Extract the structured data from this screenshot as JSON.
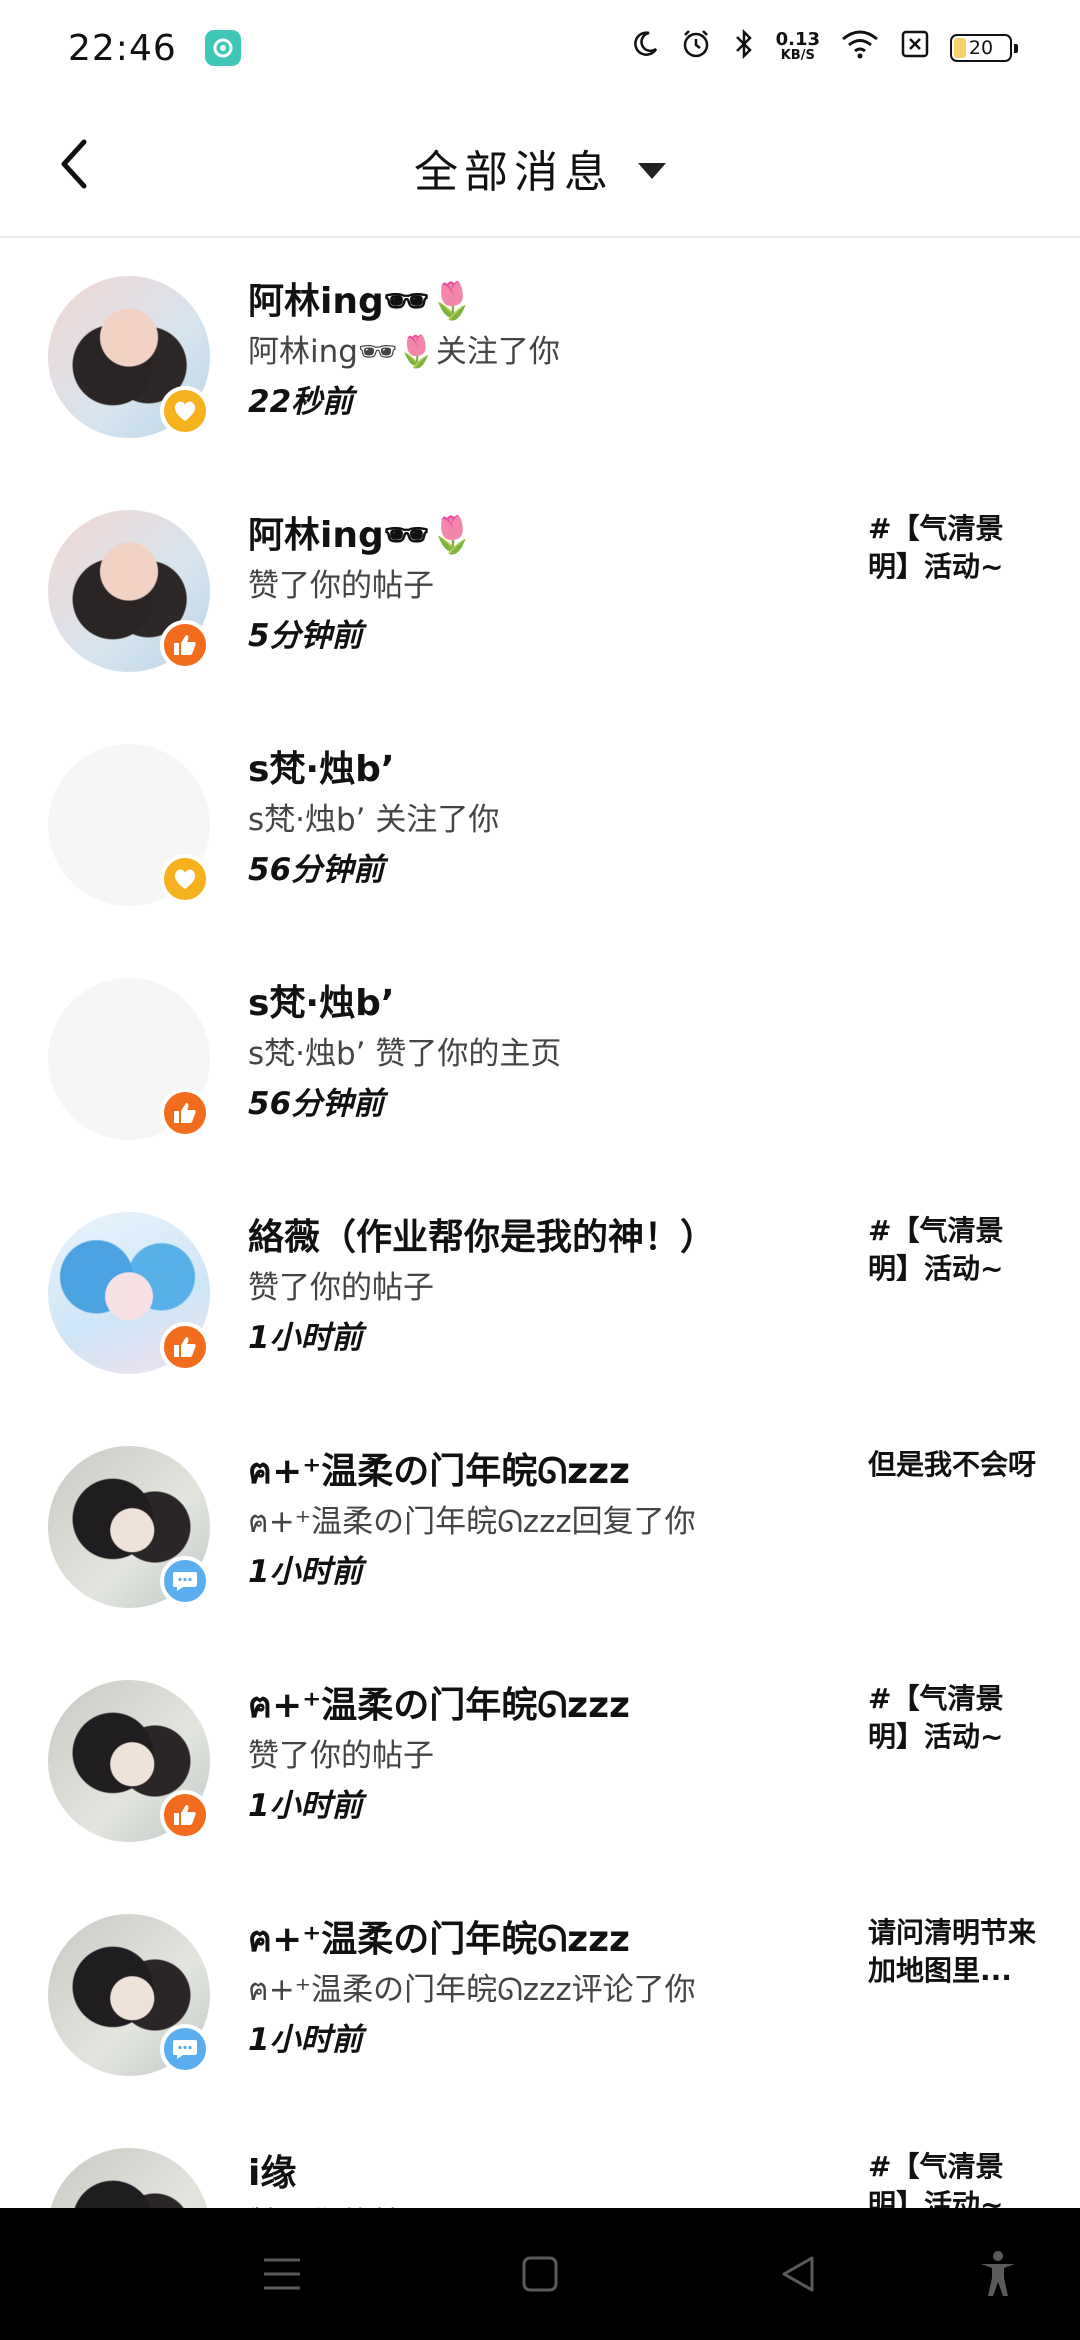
{
  "status_bar": {
    "time": "22:46",
    "net_speed": "0.13",
    "net_unit": "KB/S",
    "battery": "20",
    "battery_level": 0.2
  },
  "header": {
    "title": "全部消息"
  },
  "messages": [
    {
      "name": "阿林ing🕶🌷",
      "action": "阿林ing🕶🌷关注了你",
      "time": "22秒前",
      "snippet": "",
      "badge": "heart-icon"
    },
    {
      "name": "阿林ing🕶🌷",
      "action": "赞了你的帖子",
      "time": "5分钟前",
      "snippet": "#【气清景明】活动~",
      "badge": "like-icon"
    },
    {
      "name": "s梵·烛b’",
      "action": "s梵·烛b’ 关注了你",
      "time": "56分钟前",
      "snippet": "",
      "badge": "heart-icon"
    },
    {
      "name": "s梵·烛b’",
      "action": "s梵·烛b’ 赞了你的主页",
      "time": "56分钟前",
      "snippet": "",
      "badge": "like-icon"
    },
    {
      "name": "絡薇（作业帮你是我的神！）",
      "action": "赞了你的帖子",
      "time": "1小时前",
      "snippet": "#【气清景明】活动~",
      "badge": "like-icon"
    },
    {
      "name": "ฅ+⁺温柔の门年皖ᘏzzz",
      "action": "ฅ+⁺温柔の门年皖ᘏzzz回复了你",
      "time": "1小时前",
      "snippet": "但是我不会呀",
      "badge": "comment-icon"
    },
    {
      "name": "ฅ+⁺温柔の门年皖ᘏzzz",
      "action": "赞了你的帖子",
      "time": "1小时前",
      "snippet": "#【气清景明】活动~",
      "badge": "like-icon"
    },
    {
      "name": "ฅ+⁺温柔の门年皖ᘏzzz",
      "action": "ฅ+⁺温柔の门年皖ᘏzzz评论了你",
      "time": "1小时前",
      "snippet": "请问清明节来加地图里...",
      "badge": "comment-icon"
    },
    {
      "name": "i缘",
      "action": "赞了你的帖子",
      "time": "",
      "snippet": "#【气清景明】活动~",
      "badge": "like-icon"
    }
  ]
}
